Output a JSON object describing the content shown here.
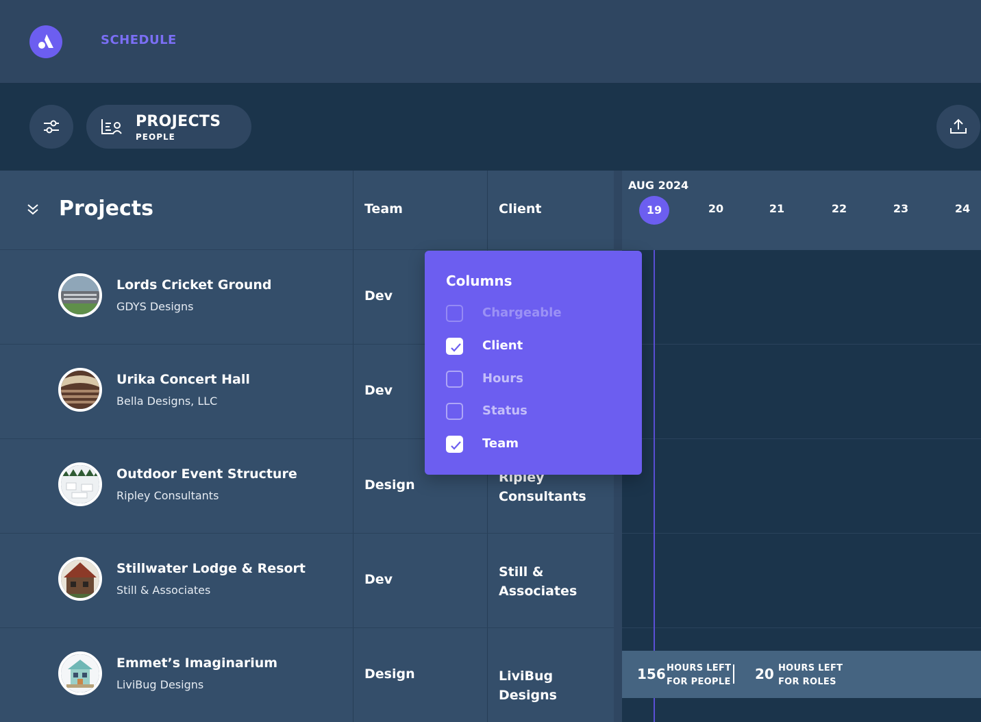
{
  "app": {
    "title": "SCHEDULE",
    "accent": "#6c5ef0"
  },
  "toolbar": {
    "view_main": "PROJECTS",
    "view_sub": "PEOPLE",
    "filter_icon": "sliders-icon",
    "export_icon": "upload-icon"
  },
  "table": {
    "title": "Projects",
    "columns": [
      "Team",
      "Client"
    ],
    "rows": [
      {
        "name": "Lords Cricket Ground",
        "sub": "GDYS Designs",
        "team": "Dev",
        "client": ""
      },
      {
        "name": "Urika Concert Hall",
        "sub": "Bella Designs, LLC",
        "team": "Dev",
        "client": ""
      },
      {
        "name": "Outdoor Event Structure",
        "sub": "Ripley Consultants",
        "team": "Design",
        "client": "Ripley Consultants"
      },
      {
        "name": "Stillwater Lodge & Resort",
        "sub": "Still & Associates",
        "team": "Dev",
        "client": "Still & Associates"
      },
      {
        "name": "Emmet’s Imaginarium",
        "sub": "LiviBug Designs",
        "team": "Design",
        "client": "LiviBug Designs"
      }
    ]
  },
  "timeline": {
    "month": "AUG 2024",
    "days": [
      "19",
      "20",
      "21",
      "22",
      "23",
      "24"
    ],
    "today": "19",
    "hours_people": "156",
    "hours_people_label_1": "HOURS LEFT",
    "hours_people_label_2": "FOR PEOPLE",
    "hours_roles": "20",
    "hours_roles_label_1": "HOURS LEFT",
    "hours_roles_label_2": "FOR ROLES"
  },
  "columns_popover": {
    "title": "Columns",
    "options": [
      {
        "label": "Chargeable",
        "checked": false,
        "disabled": true
      },
      {
        "label": "Client",
        "checked": true,
        "disabled": false
      },
      {
        "label": "Hours",
        "checked": false,
        "disabled": false
      },
      {
        "label": "Status",
        "checked": false,
        "disabled": false
      },
      {
        "label": "Team",
        "checked": true,
        "disabled": false
      }
    ]
  }
}
